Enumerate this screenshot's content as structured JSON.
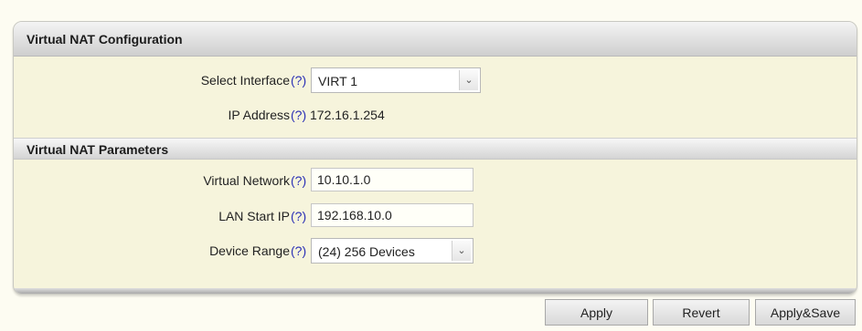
{
  "panel": {
    "title": "Virtual NAT Configuration",
    "select_interface": {
      "label": "Select Interface",
      "help": "(?)",
      "value": "VIRT 1"
    },
    "ip_address": {
      "label": "IP Address",
      "help": "(?)",
      "value": "172.16.1.254"
    }
  },
  "parameters": {
    "title": "Virtual NAT Parameters",
    "virtual_network": {
      "label": "Virtual Network",
      "help": "(?)",
      "value": "10.10.1.0"
    },
    "lan_start_ip": {
      "label": "LAN Start IP",
      "help": "(?)",
      "value": "192.168.10.0"
    },
    "device_range": {
      "label": "Device Range",
      "help": "(?)",
      "value": "(24) 256 Devices"
    }
  },
  "buttons": {
    "apply": "Apply",
    "revert": "Revert",
    "apply_save": "Apply&Save"
  },
  "icons": {
    "dropdown": "chevron-down-icon"
  }
}
